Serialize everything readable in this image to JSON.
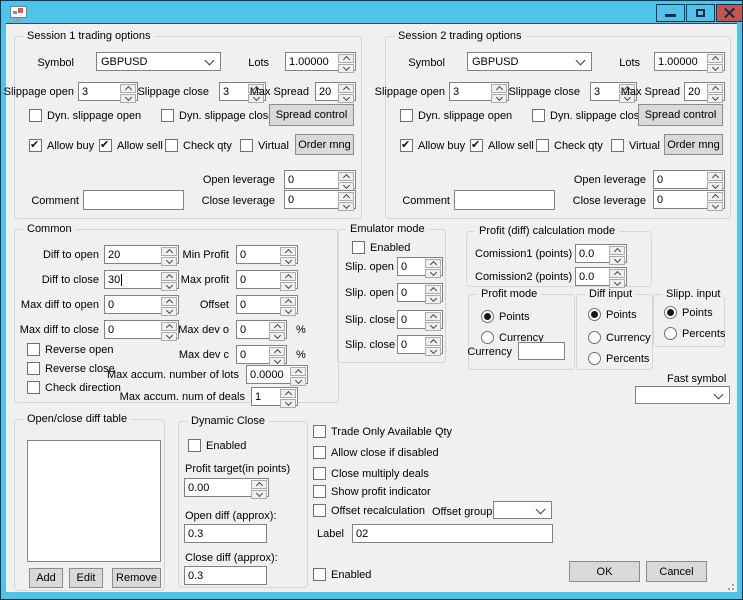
{
  "colors": {
    "titlebar": "#4fc3e8",
    "close_button": "#c75350",
    "client_bg": "#f0f0f0"
  },
  "sessions": [
    {
      "title": "Session 1 trading options",
      "symbol_label": "Symbol",
      "symbol": "GBPUSD",
      "lots_label": "Lots",
      "lots": "1.00000",
      "slippage_open_label": "Slippage open",
      "slippage_open": "3",
      "slippage_close_label": "Slippage close",
      "slippage_close": "3",
      "max_spread_label": "Max Spread",
      "max_spread": "20",
      "dyn_slippage_open_label": "Dyn. slippage open",
      "dyn_slippage_open_checked": false,
      "dyn_slippage_close_label": "Dyn. slippage close",
      "dyn_slippage_close_checked": false,
      "spread_control_button": "Spread control",
      "allow_buy_label": "Allow buy",
      "allow_buy_checked": true,
      "allow_sell_label": "Allow sell",
      "allow_sell_checked": true,
      "check_qty_label": "Check qty",
      "check_qty_checked": false,
      "virtual_label": "Virtual",
      "virtual_checked": false,
      "order_mng_button": "Order mng",
      "open_leverage_label": "Open leverage",
      "open_leverage": "0",
      "close_leverage_label": "Close leverage",
      "close_leverage": "0",
      "comment_label": "Comment",
      "comment": ""
    },
    {
      "title": "Session 2 trading options",
      "symbol_label": "Symbol",
      "symbol": "GBPUSD",
      "lots_label": "Lots",
      "lots": "1.00000",
      "slippage_open_label": "Slippage open",
      "slippage_open": "3",
      "slippage_close_label": "Slippage close",
      "slippage_close": "3",
      "max_spread_label": "Max Spread",
      "max_spread": "20",
      "dyn_slippage_open_label": "Dyn. slippage open",
      "dyn_slippage_open_checked": false,
      "dyn_slippage_close_label": "Dyn. slippage close",
      "dyn_slippage_close_checked": false,
      "spread_control_button": "Spread control",
      "allow_buy_label": "Allow buy",
      "allow_buy_checked": true,
      "allow_sell_label": "Allow sell",
      "allow_sell_checked": true,
      "check_qty_label": "Check qty",
      "check_qty_checked": false,
      "virtual_label": "Virtual",
      "virtual_checked": false,
      "order_mng_button": "Order mng",
      "open_leverage_label": "Open leverage",
      "open_leverage": "0",
      "close_leverage_label": "Close leverage",
      "close_leverage": "0",
      "comment_label": "Comment",
      "comment": ""
    }
  ],
  "common": {
    "title": "Common",
    "diff_to_open_label": "Diff to open",
    "diff_to_open": "20",
    "diff_to_close_label": "Diff to close",
    "diff_to_close": "30",
    "max_diff_to_open_label": "Max diff to open",
    "max_diff_to_open": "0",
    "max_diff_to_close_label": "Max diff to close",
    "max_diff_to_close": "0",
    "min_profit_label": "Min Profit",
    "min_profit": "0",
    "max_profit_label": "Max profit",
    "max_profit": "0",
    "offset_label": "Offset",
    "offset": "0",
    "max_dev_o_label": "Max dev o",
    "max_dev_o": "0",
    "max_dev_c_label": "Max dev c",
    "max_dev_c": "0",
    "percent": "%",
    "reverse_open_label": "Reverse open",
    "reverse_open_checked": false,
    "reverse_close_label": "Reverse close",
    "reverse_close_checked": false,
    "check_direction_label": "Check direction",
    "check_direction_checked": false,
    "max_accum_lots_label": "Max accum. number of lots",
    "max_accum_lots": "0.0000",
    "max_accum_deals_label": "Max accum. num of deals",
    "max_accum_deals": "1"
  },
  "emulator": {
    "title": "Emulator mode",
    "enabled_label": "Enabled",
    "enabled_checked": false,
    "rows": [
      {
        "label": "Slip. open",
        "value": "0"
      },
      {
        "label": "Slip. open",
        "value": "0"
      },
      {
        "label": "Slip. close",
        "value": "0"
      },
      {
        "label": "Slip. close",
        "value": "0"
      }
    ]
  },
  "profit_calc": {
    "title": "Profit (diff) calculation mode",
    "comission1_label": "Comission1 (points)",
    "comission1": "0.0",
    "comission2_label": "Comission2 (points)",
    "comission2": "0.0"
  },
  "profit_mode": {
    "title": "Profit mode",
    "points_label": "Points",
    "points_selected": true,
    "currency_label": "Currency",
    "currency_selected": false,
    "currency_field_label": "Currency",
    "currency_value": ""
  },
  "diff_input": {
    "title": "Diff input",
    "points_label": "Points",
    "points_selected": true,
    "currency_label": "Currency",
    "currency_selected": false,
    "percents_label": "Percents",
    "percents_selected": false
  },
  "slipp_input": {
    "title": "Slipp. input",
    "points_label": "Points",
    "points_selected": true,
    "percents_label": "Percents",
    "percents_selected": false
  },
  "fast_symbol": {
    "label": "Fast symbol",
    "value": ""
  },
  "diff_table": {
    "title": "Open/close diff table",
    "add_button": "Add",
    "edit_button": "Edit",
    "remove_button": "Remove"
  },
  "dynamic_close": {
    "title": "Dynamic Close",
    "enabled_label": "Enabled",
    "enabled_checked": false,
    "profit_target_label": "Profit target(in points)",
    "profit_target": "0.00",
    "open_diff_label": "Open diff (approx):",
    "open_diff": "0.3",
    "close_diff_label": "Close diff (approx):",
    "close_diff": "0.3"
  },
  "options": {
    "trade_only_label": "Trade Only Available Qty",
    "trade_only_checked": false,
    "allow_close_label": "Allow close if disabled",
    "allow_close_checked": false,
    "close_multiply_label": "Close multiply deals",
    "close_multiply_checked": false,
    "show_profit_label": "Show profit indicator",
    "show_profit_checked": false,
    "offset_recalc_label": "Offset recalculation",
    "offset_recalc_checked": false,
    "offset_group_label": "Offset group",
    "offset_group_value": "",
    "label_label": "Label",
    "label_value": "02",
    "enabled_label": "Enabled",
    "enabled_checked": false
  },
  "footer": {
    "ok_button": "OK",
    "cancel_button": "Cancel"
  }
}
